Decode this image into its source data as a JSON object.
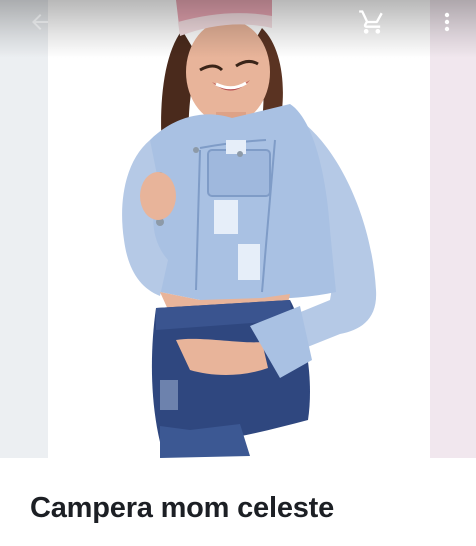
{
  "app_bar": {
    "back_icon": "arrow-back-icon",
    "cart_icon": "shopping-cart-icon",
    "menu_icon": "more-vertical-icon",
    "icon_color": "#ffffff"
  },
  "product": {
    "title": "Campera mom celeste",
    "image_subject": "model wearing cropped light-blue distressed denim jacket and dark denim shorts"
  },
  "colors": {
    "title_text": "#1c1f24",
    "jacket": "#a9c1e3",
    "shorts": "#2f477f",
    "background": "#ffffff"
  }
}
